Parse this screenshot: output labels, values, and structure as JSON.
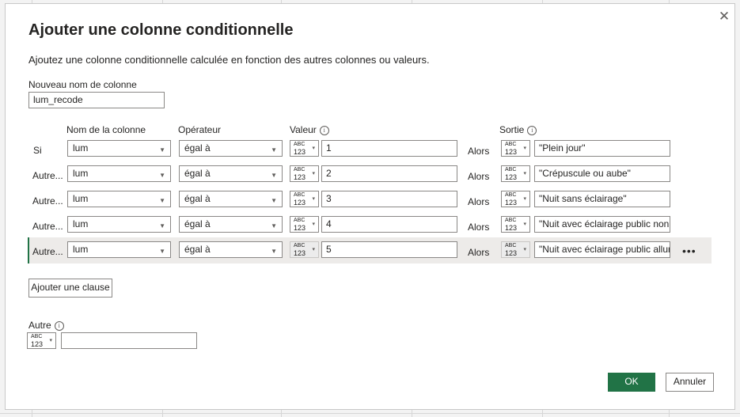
{
  "dialog": {
    "title": "Ajouter une colonne conditionnelle",
    "description": "Ajoutez une colonne conditionnelle calculée en fonction des autres colonnes ou valeurs.",
    "close_icon": "close-icon"
  },
  "new_column": {
    "label": "Nouveau nom de colonne",
    "value": "lum_recode"
  },
  "headers": {
    "column_name": "Nom de la colonne",
    "operator": "Opérateur",
    "value": "Valeur",
    "output": "Sortie",
    "info_glyph": "i"
  },
  "type_icon": {
    "abc": "ABC",
    "num": "123",
    "chevron": "▾"
  },
  "clauses": [
    {
      "prefix": "Si",
      "column": "lum",
      "operator": "égal à",
      "value": "1",
      "then": "Alors",
      "output": "\"Plein jour\""
    },
    {
      "prefix": "Autre...",
      "column": "lum",
      "operator": "égal à",
      "value": "2",
      "then": "Alors",
      "output": "\"Crépuscule ou aube\""
    },
    {
      "prefix": "Autre...",
      "column": "lum",
      "operator": "égal à",
      "value": "3",
      "then": "Alors",
      "output": "\"Nuit sans éclairage\""
    },
    {
      "prefix": "Autre...",
      "column": "lum",
      "operator": "égal à",
      "value": "4",
      "then": "Alors",
      "output": "\"Nuit avec éclairage public non a"
    },
    {
      "prefix": "Autre...",
      "column": "lum",
      "operator": "égal à",
      "value": "5",
      "then": "Alors",
      "output": "\"Nuit avec éclairage public allur"
    }
  ],
  "more_label": "•••",
  "add_clause_label": "Ajouter une clause",
  "else": {
    "label": "Autre",
    "value": ""
  },
  "buttons": {
    "ok": "OK",
    "cancel": "Annuler",
    "close_glyph": "✕"
  },
  "colors": {
    "accent": "#217346",
    "border": "#8a8886"
  }
}
